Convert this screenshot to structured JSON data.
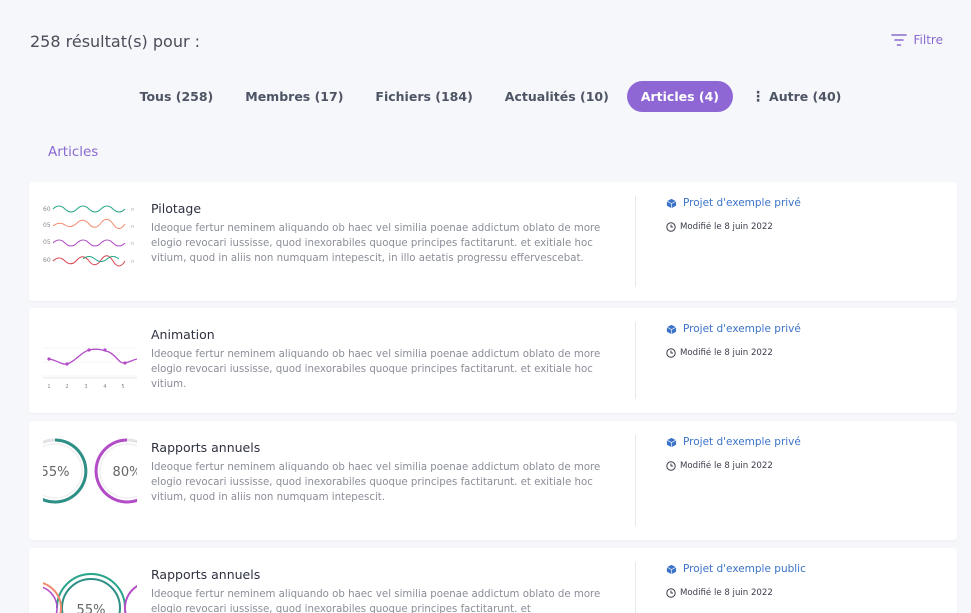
{
  "header": {
    "results": "258 résultat(s) pour :",
    "filter_label": "Filtre"
  },
  "tabs": [
    {
      "label": "Tous (258)"
    },
    {
      "label": "Membres (17)"
    },
    {
      "label": "Fichiers (184)"
    },
    {
      "label": "Actualités (10)"
    },
    {
      "label": "Articles (4)",
      "active": true
    },
    {
      "label": "Autre (40)"
    }
  ],
  "section": {
    "title": "Articles"
  },
  "colors": {
    "accent": "#8e67d4",
    "link": "#3b73c8"
  },
  "articles": [
    {
      "title": "Pilotage",
      "description": "Ideoque fertur neminem aliquando ob haec vel similia poenae addictum oblato de more elogio revocari iussisse, quod inexorabiles quoque principes factitarunt. et exitiale hoc vitium, quod in aliis non numquam intepescit, in illo aetatis progressu effervescebat.",
      "project": "Projet d'exemple privé",
      "modified": "Modifié le 8 juin 2022",
      "thumb": {
        "kind": "sparklines",
        "labels": [
          "60",
          "05",
          "05",
          "60"
        ]
      }
    },
    {
      "title": "Animation",
      "description": "Ideoque fertur neminem aliquando ob haec vel similia poenae addictum oblato de more elogio revocari iussisse, quod inexorabiles quoque principes factitarunt. et exitiale hoc vitium.",
      "project": "Projet d'exemple privé",
      "modified": "Modifié le 8 juin 2022",
      "thumb": {
        "kind": "linechart",
        "xticks": [
          "1",
          "2",
          "3",
          "4",
          "5"
        ]
      }
    },
    {
      "title": "Rapports annuels",
      "description": "Ideoque fertur neminem aliquando ob haec vel similia poenae addictum oblato de more elogio revocari iussisse, quod inexorabiles quoque principes factitarunt. et exitiale hoc vitium, quod in aliis non numquam intepescit.",
      "project": "Projet d'exemple privé",
      "modified": "Modifié le 8 juin 2022",
      "thumb": {
        "kind": "rings",
        "values": [
          "55%",
          "80%"
        ]
      }
    },
    {
      "title": "Rapports annuels",
      "description": "Ideoque fertur neminem aliquando ob haec vel similia poenae addictum oblato de more elogio revocari iussisse, quod inexorabiles quoque principes factitarunt. et",
      "project": "Projet d'exemple public",
      "modified": "Modifié le 8 juin 2022",
      "thumb": {
        "kind": "rings-multi",
        "values": [
          "55%"
        ]
      }
    }
  ]
}
